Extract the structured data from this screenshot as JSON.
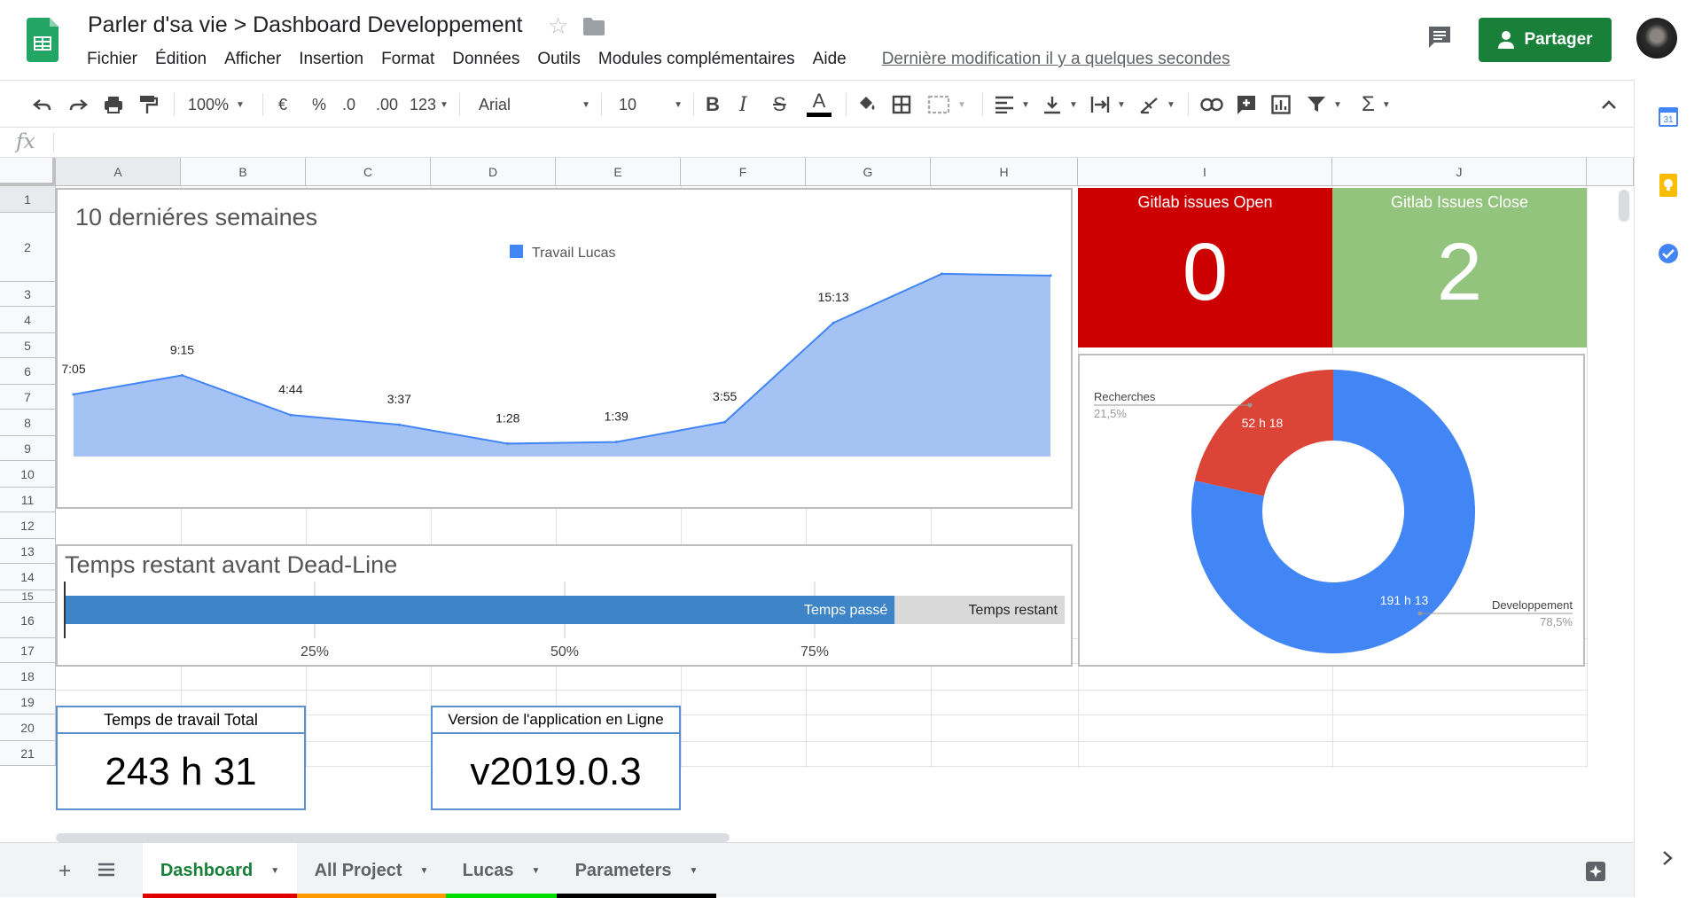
{
  "app": {
    "title": "Parler d'sa vie > Dashboard Developpement",
    "menu": [
      "Fichier",
      "Édition",
      "Afficher",
      "Insertion",
      "Format",
      "Données",
      "Outils",
      "Modules complémentaires",
      "Aide"
    ],
    "last_edit": "Dernière modification il y a quelques secondes",
    "share_label": "Partager",
    "brand_color": "#188038"
  },
  "toolbar": {
    "zoom": "100%",
    "currency": "€",
    "percent": "%",
    "dec_less": ".0",
    "dec_more": ".00",
    "format_more": "123",
    "font": "Arial",
    "font_size": "10",
    "icons": [
      "undo-icon",
      "redo-icon",
      "print-icon",
      "paint-format-icon",
      "bold-icon",
      "italic-icon",
      "strikethrough-icon",
      "text-color-icon",
      "fill-color-icon",
      "borders-icon",
      "merge-icon",
      "align-icon",
      "valign-icon",
      "wrap-icon",
      "rotate-icon",
      "link-icon",
      "comment-add-icon",
      "chart-icon",
      "filter-icon",
      "functions-icon",
      "collapse-icon"
    ]
  },
  "formula_bar": {
    "label": "fx",
    "value": ""
  },
  "columns": [
    "A",
    "B",
    "C",
    "D",
    "E",
    "F",
    "G",
    "H",
    "I",
    "J"
  ],
  "rows": [
    "1",
    "2",
    "3",
    "4",
    "5",
    "6",
    "7",
    "8",
    "9",
    "10",
    "11",
    "12",
    "13",
    "14",
    "15",
    "16",
    "17",
    "18",
    "19",
    "20",
    "21"
  ],
  "kpis": {
    "open": {
      "title": "Gitlab issues Open",
      "value": "0",
      "color": "#cc0000"
    },
    "close": {
      "title": "Gitlab Issues Close",
      "value": "2",
      "color": "#93c47d"
    }
  },
  "stats": {
    "total_time": {
      "label": "Temps de travail Total",
      "value": "243 h 31"
    },
    "version": {
      "label": "Version de l'application en Ligne",
      "value": "v2019.0.3"
    }
  },
  "tabs": [
    {
      "label": "Dashboard",
      "color": "#e00000",
      "active": true
    },
    {
      "label": "All Project",
      "color": "#ff9900",
      "active": false
    },
    {
      "label": "Lucas",
      "color": "#00dd00",
      "active": false
    },
    {
      "label": "Parameters",
      "color": "#000000",
      "active": false
    }
  ],
  "chart_data": [
    {
      "type": "area",
      "title": "10 derniéres semaines",
      "legend": "top-center",
      "series": [
        {
          "name": "Travail Lucas",
          "color": "#4285f4",
          "values_hours": [
            7.08,
            9.25,
            4.73,
            3.62,
            1.47,
            1.65,
            3.92,
            15.22,
            20.8,
            20.6
          ],
          "labels": [
            "7:05",
            "9:15",
            "4:44",
            "3:37",
            "1:28",
            "1:39",
            "3:55",
            "15:13",
            "",
            ""
          ]
        }
      ]
    },
    {
      "type": "bar",
      "title": "Temps restant avant Dead-Line",
      "orientation": "horizontal-stacked",
      "series": [
        {
          "name": "Temps passé",
          "value": 83,
          "color": "#3d85c6"
        },
        {
          "name": "Temps restant",
          "value": 17,
          "color": "#d9d9d9"
        }
      ],
      "ticks": [
        "25%",
        "50%",
        "75%"
      ],
      "xlim": [
        0,
        100
      ]
    },
    {
      "type": "pie",
      "donut": true,
      "slices": [
        {
          "name": "Developpement",
          "value": 78.5,
          "pct_label": "78,5%",
          "inner_label": "191 h 13",
          "color": "#4285f4"
        },
        {
          "name": "Recherches",
          "value": 21.5,
          "pct_label": "21,5%",
          "inner_label": "52 h 18",
          "color": "#db4437"
        }
      ]
    }
  ]
}
